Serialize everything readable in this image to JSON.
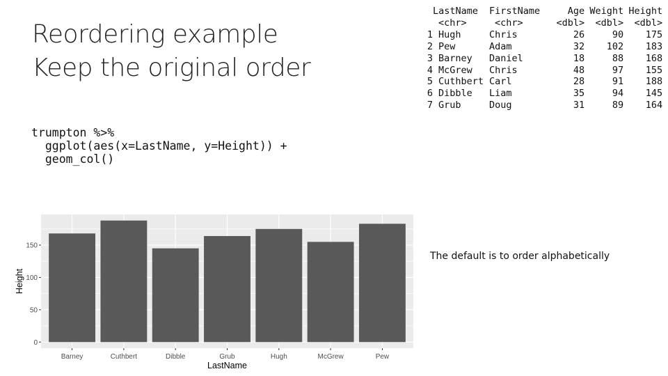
{
  "slide": {
    "title_lines": [
      "Reordering example",
      "Keep the original order"
    ],
    "code_lines": [
      "trumpton %>%",
      "  ggplot(aes(x=LastName, y=Height)) +",
      "  geom_col()"
    ],
    "note": "The default is to order alphabetically"
  },
  "table": {
    "columns": [
      "LastName",
      "FirstName",
      "Age",
      "Weight",
      "Height"
    ],
    "types": [
      "<chr>",
      "<chr>",
      "<dbl>",
      "<dbl>",
      "<dbl>"
    ],
    "rows": [
      {
        "idx": "1",
        "cells": [
          "Hugh",
          "Chris",
          "26",
          "90",
          "175"
        ]
      },
      {
        "idx": "2",
        "cells": [
          "Pew",
          "Adam",
          "32",
          "102",
          "183"
        ]
      },
      {
        "idx": "3",
        "cells": [
          "Barney",
          "Daniel",
          "18",
          "88",
          "168"
        ]
      },
      {
        "idx": "4",
        "cells": [
          "McGrew",
          "Chris",
          "48",
          "97",
          "155"
        ]
      },
      {
        "idx": "5",
        "cells": [
          "Cuthbert",
          "Carl",
          "28",
          "91",
          "188"
        ]
      },
      {
        "idx": "6",
        "cells": [
          "Dibble",
          "Liam",
          "35",
          "94",
          "145"
        ]
      },
      {
        "idx": "7",
        "cells": [
          "Grub",
          "Doug",
          "31",
          "89",
          "164"
        ]
      }
    ]
  },
  "chart_data": {
    "type": "bar",
    "title": "",
    "xlabel": "LastName",
    "ylabel": "Height",
    "categories": [
      "Barney",
      "Cuthbert",
      "Dibble",
      "Grub",
      "Hugh",
      "McGrew",
      "Pew"
    ],
    "values": [
      168,
      188,
      145,
      164,
      175,
      155,
      183
    ],
    "yticks": [
      0,
      50,
      100,
      150
    ],
    "ylim": [
      -9.4,
      197.4
    ],
    "grid": true,
    "colors": {
      "bar": "#595959",
      "panel": "#ebebeb",
      "grid": "#ffffff",
      "tick_text": "#4d4d4d"
    }
  }
}
